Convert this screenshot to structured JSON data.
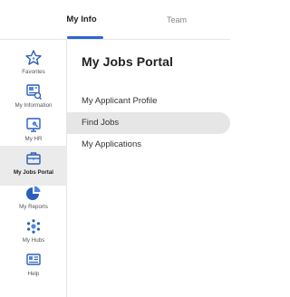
{
  "tabs": {
    "my_info": "My Info",
    "team": "Team"
  },
  "sidebar": {
    "items": [
      {
        "label": "Favorites",
        "icon": "star-icon"
      },
      {
        "label": "My Information",
        "icon": "profile-card-icon"
      },
      {
        "label": "My HR",
        "icon": "hr-monitor-icon"
      },
      {
        "label": "My Jobs Portal",
        "icon": "briefcase-icon",
        "active": true
      },
      {
        "label": "My Reports",
        "icon": "pie-chart-icon"
      },
      {
        "label": "My Hubs",
        "icon": "hub-icon"
      },
      {
        "label": "Help",
        "icon": "help-card-icon"
      }
    ]
  },
  "main": {
    "title": "My Jobs Portal",
    "menu": [
      {
        "label": "My Applicant Profile"
      },
      {
        "label": "Find Jobs",
        "active": true
      },
      {
        "label": "My Applications"
      }
    ]
  },
  "colors": {
    "accent": "#2d65d6",
    "active_bg": "#e6e6e6",
    "icon": "#2c5fb8"
  }
}
